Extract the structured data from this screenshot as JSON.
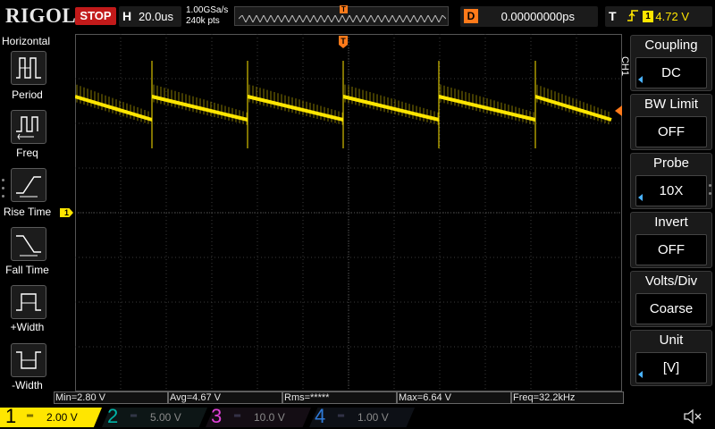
{
  "topbar": {
    "brand": "RIGOL",
    "run_state": "STOP",
    "horizontal_label": "H",
    "timebase": "20.0us",
    "sample_rate": "1.00GSa/s",
    "memory_points": "240k pts",
    "trigger_marker": "T",
    "delay_label": "D",
    "delay_value": "0.00000000ps",
    "trigger_label": "T",
    "trigger_edge": "rising-edge",
    "trigger_source": "1",
    "trigger_level": "4.72 V"
  },
  "left_panel": {
    "title": "Horizontal",
    "items": [
      {
        "label": "Period",
        "icon": "period-icon"
      },
      {
        "label": "Freq",
        "icon": "frequency-icon"
      },
      {
        "label": "Rise Time",
        "icon": "rise-time-icon"
      },
      {
        "label": "Fall Time",
        "icon": "fall-time-icon"
      },
      {
        "label": "+Width",
        "icon": "positive-width-icon"
      },
      {
        "label": "-Width",
        "icon": "negative-width-icon"
      }
    ]
  },
  "grid": {
    "channel_marker": "1",
    "trigger_marker": "T",
    "trace_color": "#ffe600"
  },
  "right_menu": {
    "channel_tag": "CH1",
    "items": [
      {
        "title": "Coupling",
        "value": "DC",
        "has_arrow": true
      },
      {
        "title": "BW Limit",
        "value": "OFF",
        "has_arrow": false
      },
      {
        "title": "Probe",
        "value": "10X",
        "has_arrow": true
      },
      {
        "title": "Invert",
        "value": "OFF",
        "has_arrow": false
      },
      {
        "title": "Volts/Div",
        "value": "Coarse",
        "has_arrow": false
      },
      {
        "title": "Unit",
        "value": "[V]",
        "has_arrow": true
      }
    ]
  },
  "measurements": [
    "Min=2.80 V",
    "Avg=4.67 V",
    "Rms=*****",
    "Max=6.64 V",
    "Freq=32.2kHz"
  ],
  "channels": [
    {
      "num": "1",
      "scale": "2.00 V",
      "color": "#ffe600",
      "active": true
    },
    {
      "num": "2",
      "scale": "5.00 V",
      "color": "#00b5a8",
      "active": false
    },
    {
      "num": "3",
      "scale": "10.0 V",
      "color": "#e040d8",
      "active": false
    },
    {
      "num": "4",
      "scale": "1.00 V",
      "color": "#2f7bd9",
      "active": false
    }
  ],
  "speaker_icon": "speaker-muted-icon",
  "colors": {
    "stop": "#c21a1a",
    "accent": "#ff7a1a",
    "ch1": "#ffe600",
    "arrow": "#4ab3ff"
  }
}
